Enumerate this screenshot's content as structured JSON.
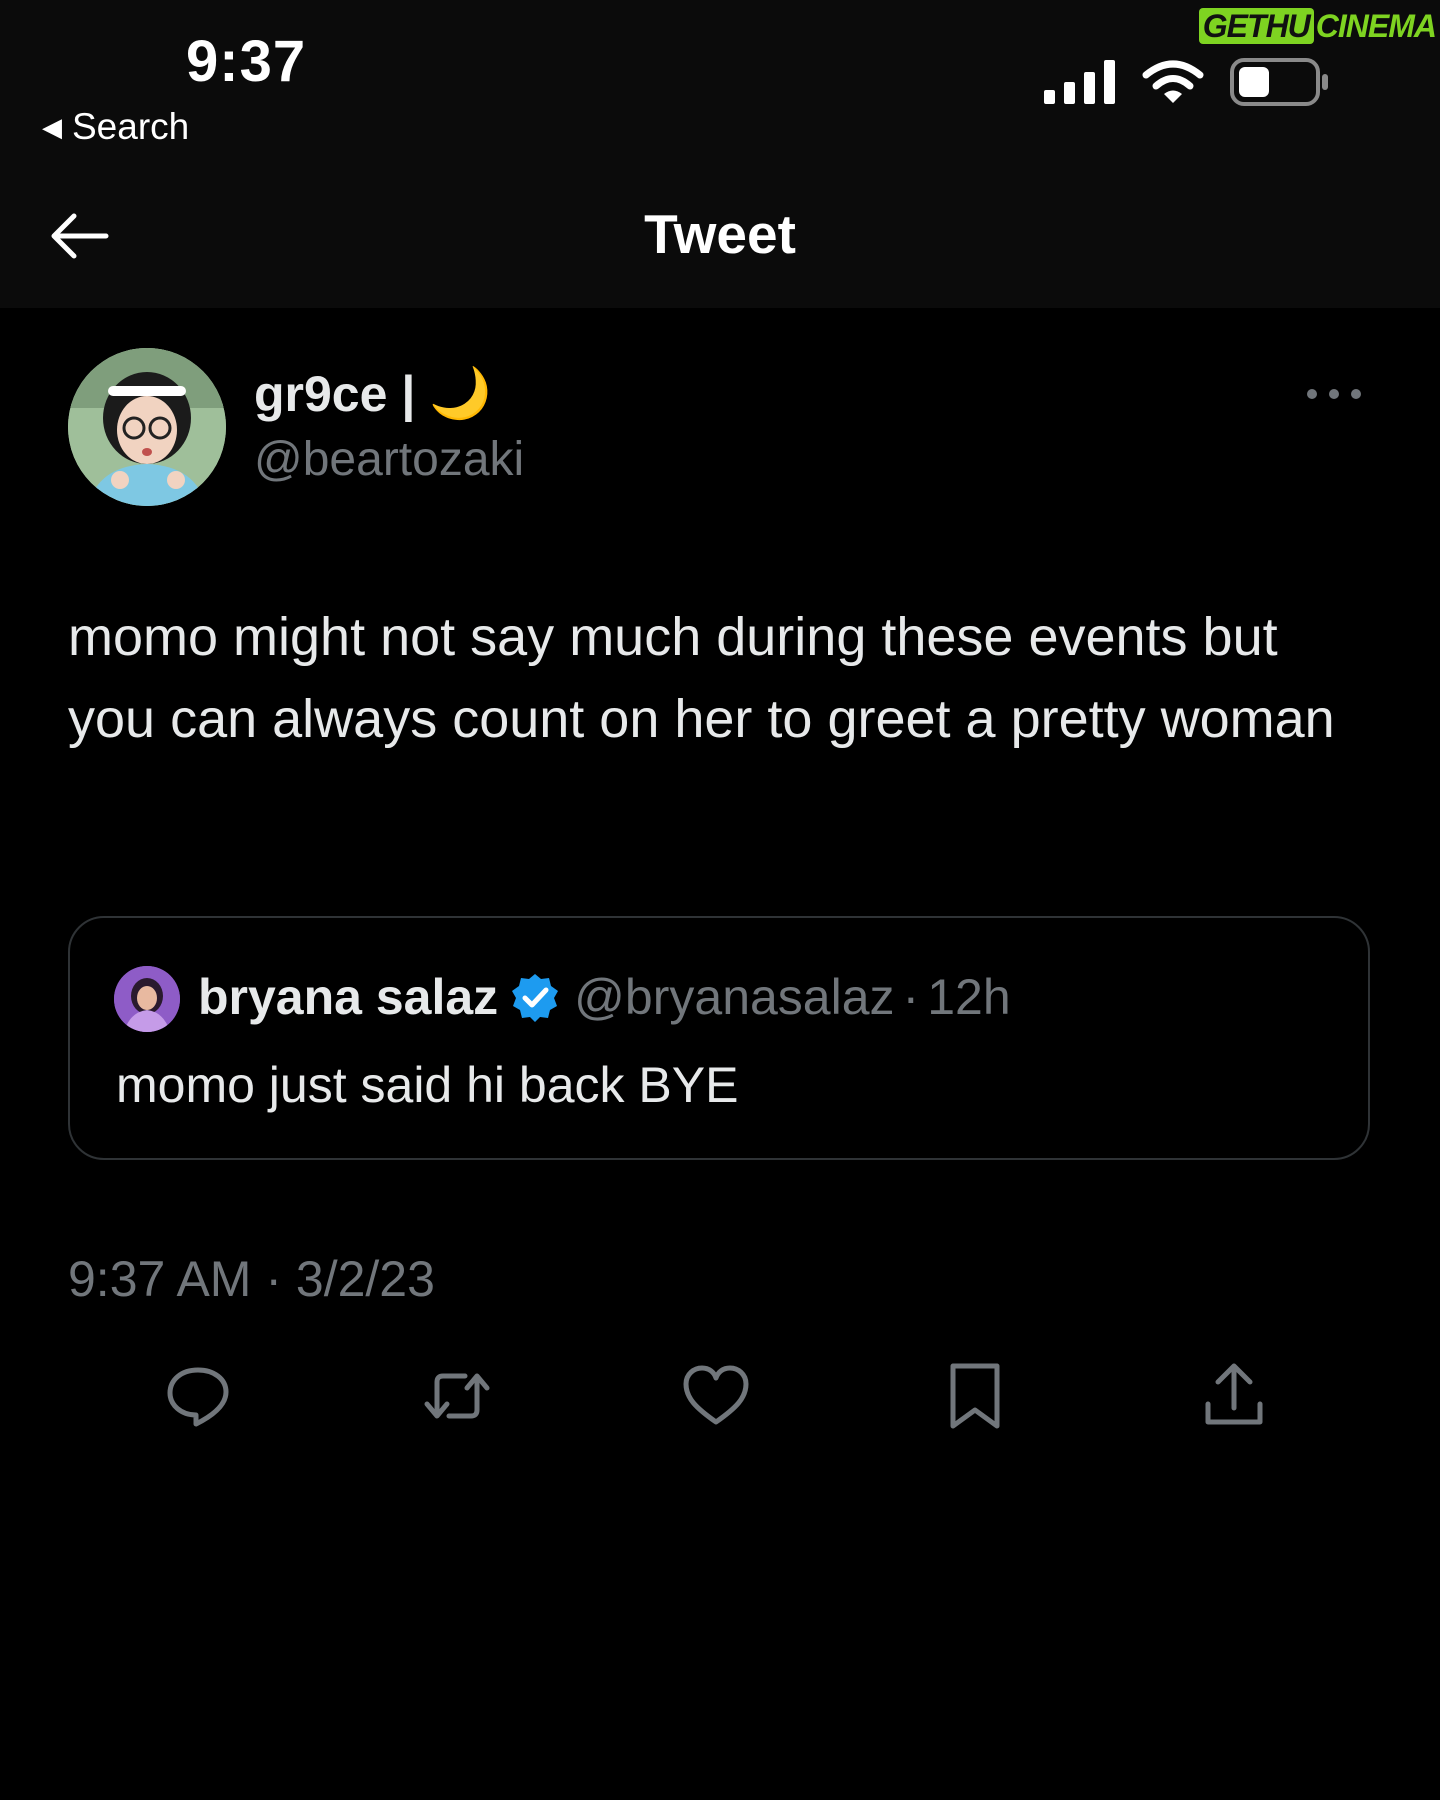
{
  "status_bar": {
    "time": "9:37",
    "back_label": "Search",
    "watermark_a": "GETHU",
    "watermark_b": "CINEMA"
  },
  "nav": {
    "title": "Tweet"
  },
  "tweet": {
    "author_name": "gr9ce |",
    "author_emoji": "🌙",
    "author_handle": "@beartozaki",
    "text": "momo might not say much during these events but you can always count on her to greet a pretty woman",
    "timestamp": "9:37 AM · 3/2/23"
  },
  "quote": {
    "author_name": "bryana salaz",
    "author_handle": "@bryanasalaz",
    "separator": "·",
    "time": "12h",
    "text": "momo just said hi back BYE"
  },
  "icons": {
    "back": "back-chevron-icon",
    "signal": "cellular-signal-icon",
    "wifi": "wifi-icon",
    "battery": "battery-icon",
    "arrow_left": "arrow-left-icon",
    "more": "more-horizontal-icon",
    "verified": "verified-badge-icon",
    "reply": "reply-icon",
    "retweet": "retweet-icon",
    "like": "heart-icon",
    "bookmark": "bookmark-icon",
    "share": "share-icon"
  },
  "colors": {
    "background": "#000000",
    "text_primary": "#e7e9ea",
    "text_secondary": "#71767b",
    "border": "#2f3336",
    "verified_blue": "#1d9bf0",
    "watermark_green": "#7ed321"
  }
}
